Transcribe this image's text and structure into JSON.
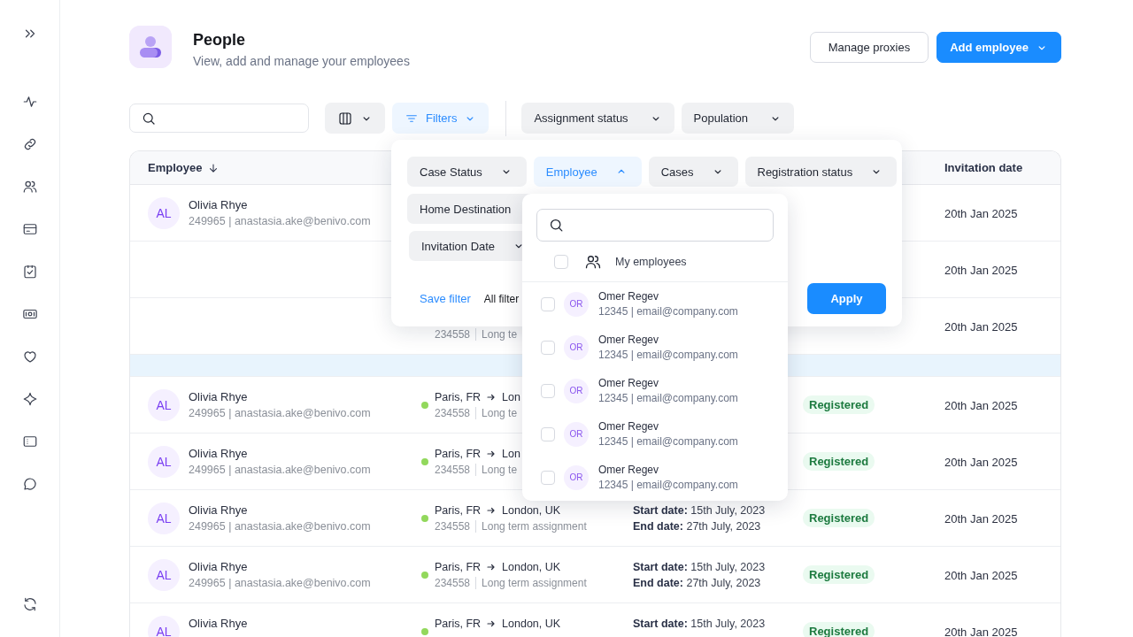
{
  "page": {
    "title": "People",
    "subtitle": "View, add and manage your employees"
  },
  "header_buttons": [
    {
      "kind": "secondary",
      "label": "Manage proxies"
    },
    {
      "kind": "primary",
      "label": "Add employee"
    }
  ],
  "toolbar": {
    "buttons": [
      {
        "kind": "columns",
        "active": false
      },
      {
        "kind": "filter",
        "label": "Filters",
        "active": true
      },
      {
        "kind": "dropdown",
        "label": "Assignment status",
        "active": false
      },
      {
        "kind": "dropdown",
        "label": "Population",
        "active": false
      }
    ]
  },
  "filter_panel": {
    "chip_rows": [
      [
        {
          "kind": "dropdown",
          "label": "Case Status",
          "expanded": false
        },
        {
          "kind": "dropdown",
          "label": "Employee",
          "expanded": true
        },
        {
          "kind": "dropdown",
          "label": "Cases",
          "expanded": false
        },
        {
          "kind": "dropdown",
          "label": "Registration status",
          "expanded": false
        }
      ],
      [
        {
          "kind": "covered",
          "label": "Home Destination",
          "expanded": false
        }
      ],
      [
        {
          "kind": "dropdown",
          "label": "Invitation Date",
          "expanded": false
        }
      ]
    ],
    "save_link": "Save filter",
    "all_filters_link": "All filter",
    "apply_button": "Apply"
  },
  "employee_dropdown": {
    "my_employees": {
      "label": "My employees",
      "checked": false
    },
    "options": [
      {
        "initials": "OR",
        "name": "Omer Regev",
        "detail": "12345 | email@company.com",
        "checked": false
      },
      {
        "initials": "OR",
        "name": "Omer Regev",
        "detail": "12345 | email@company.com",
        "checked": false
      },
      {
        "initials": "OR",
        "name": "Omer Regev",
        "detail": "12345 | email@company.com",
        "checked": false
      },
      {
        "initials": "OR",
        "name": "Omer Regev",
        "detail": "12345 | email@company.com",
        "checked": false
      },
      {
        "initials": "OR",
        "name": "Omer Regev",
        "detail": "12345 | email@company.com",
        "checked": false
      }
    ]
  },
  "table": {
    "columns": [
      {
        "label": "Employee",
        "sorted": true
      },
      {
        "label": "Invitation date",
        "sorted": false
      }
    ],
    "rows": [
      {
        "kind": "entry",
        "selected": false,
        "employee": {
          "initials": "AL",
          "name": "Olivia Rhye",
          "detail": "249965 | anastasia.ake@benivo.com"
        },
        "invitation_date": "20th Jan 2025"
      },
      {
        "kind": "entry",
        "selected": false,
        "invitation_date": "20th Jan 2025"
      },
      {
        "kind": "entry",
        "selected": false,
        "route": {
          "id": "234558",
          "type": "Long te"
        },
        "invitation_date": "20th Jan 2025"
      },
      {
        "kind": "band",
        "selected": true
      },
      {
        "kind": "entry",
        "selected": false,
        "employee": {
          "initials": "AL",
          "name": "Olivia Rhye",
          "detail": "249965 | anastasia.ake@benivo.com"
        },
        "route": {
          "color": "#92d85c",
          "from": "Paris, FR",
          "to": "Lon",
          "id": "234558",
          "type": "Long te"
        },
        "registration": "Registered",
        "invitation_date": "20th Jan 2025"
      },
      {
        "kind": "entry",
        "selected": false,
        "employee": {
          "initials": "AL",
          "name": "Olivia Rhye",
          "detail": "249965 | anastasia.ake@benivo.com"
        },
        "route": {
          "color": "#92d85c",
          "from": "Paris, FR",
          "to": "Lon",
          "id": "234558",
          "type": "Long te"
        },
        "registration": "Registered",
        "invitation_date": "20th Jan 2025"
      },
      {
        "kind": "entry",
        "selected": false,
        "employee": {
          "initials": "AL",
          "name": "Olivia Rhye",
          "detail": "249965 | anastasia.ake@benivo.com"
        },
        "route": {
          "color": "#92d85c",
          "from": "Paris, FR",
          "to": "London, UK",
          "id": "234558",
          "type": "Long term assignment"
        },
        "dates": {
          "start": "**Start date:** 15th July, 2023",
          "end": "**End date:** 27th July, 2023"
        },
        "registration": "Registered",
        "invitation_date": "20th Jan 2025"
      },
      {
        "kind": "entry",
        "selected": false,
        "employee": {
          "initials": "AL",
          "name": "Olivia Rhye",
          "detail": "249965 | anastasia.ake@benivo.com"
        },
        "route": {
          "color": "#92d85c",
          "from": "Paris, FR",
          "to": "London, UK",
          "id": "234558",
          "type": "Long term assignment"
        },
        "dates": {
          "start": "**Start date:** 15th July, 2023",
          "end": "**End date:** 27th July, 2023"
        },
        "registration": "Registered",
        "invitation_date": "20th Jan 2025"
      },
      {
        "kind": "entry",
        "selected": false,
        "employee": {
          "initials": "AL",
          "name": "Olivia Rhye"
        },
        "route": {
          "color": "#92d85c",
          "from": "Paris, FR",
          "to": "London, UK"
        },
        "dates": {
          "start": "**Start date:** 15th July, 2023"
        },
        "registration": "Registered",
        "invitation_date": "20th Jan 2025"
      }
    ]
  }
}
